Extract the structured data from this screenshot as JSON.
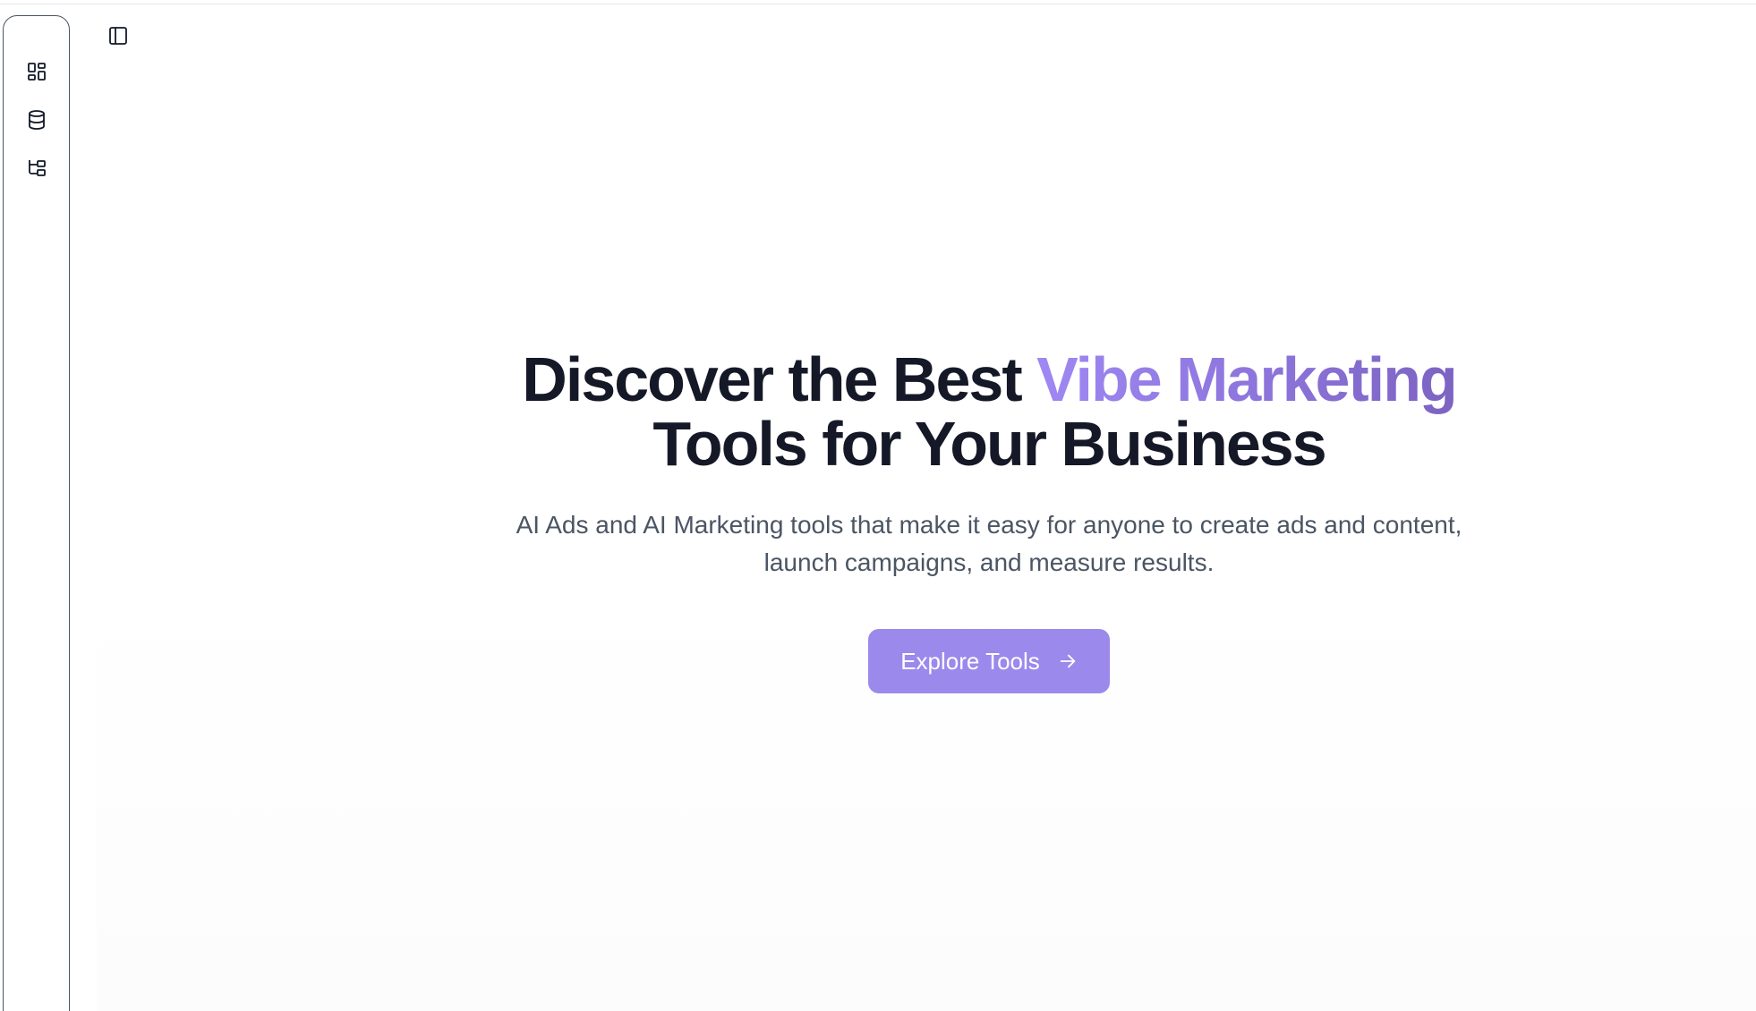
{
  "rail": {
    "items": [
      {
        "icon": "dashboard-icon",
        "label": ""
      },
      {
        "icon": "database-icon",
        "label": ""
      },
      {
        "icon": "tree-icon",
        "label": ""
      }
    ]
  },
  "toolbar": {
    "toggle_icon": "sidebar-toggle-icon"
  },
  "hero": {
    "title_prefix": "Discover the Best ",
    "title_accent": "Vibe Marketing",
    "title_suffix": "Tools for Your Business",
    "subtitle_line1": "AI Ads and AI Marketing tools that make it easy for anyone to create ads and content,",
    "subtitle_line2": "launch campaigns, and measure results.",
    "cta_label": "Explore Tools",
    "cta_icon": "arrow-right-icon"
  },
  "colors": {
    "accent": "#9b89ec",
    "accent_text_start": "#9f88f3",
    "accent_text_end": "#7c63c2",
    "title": "#151826",
    "subtitle": "#4b5563"
  }
}
